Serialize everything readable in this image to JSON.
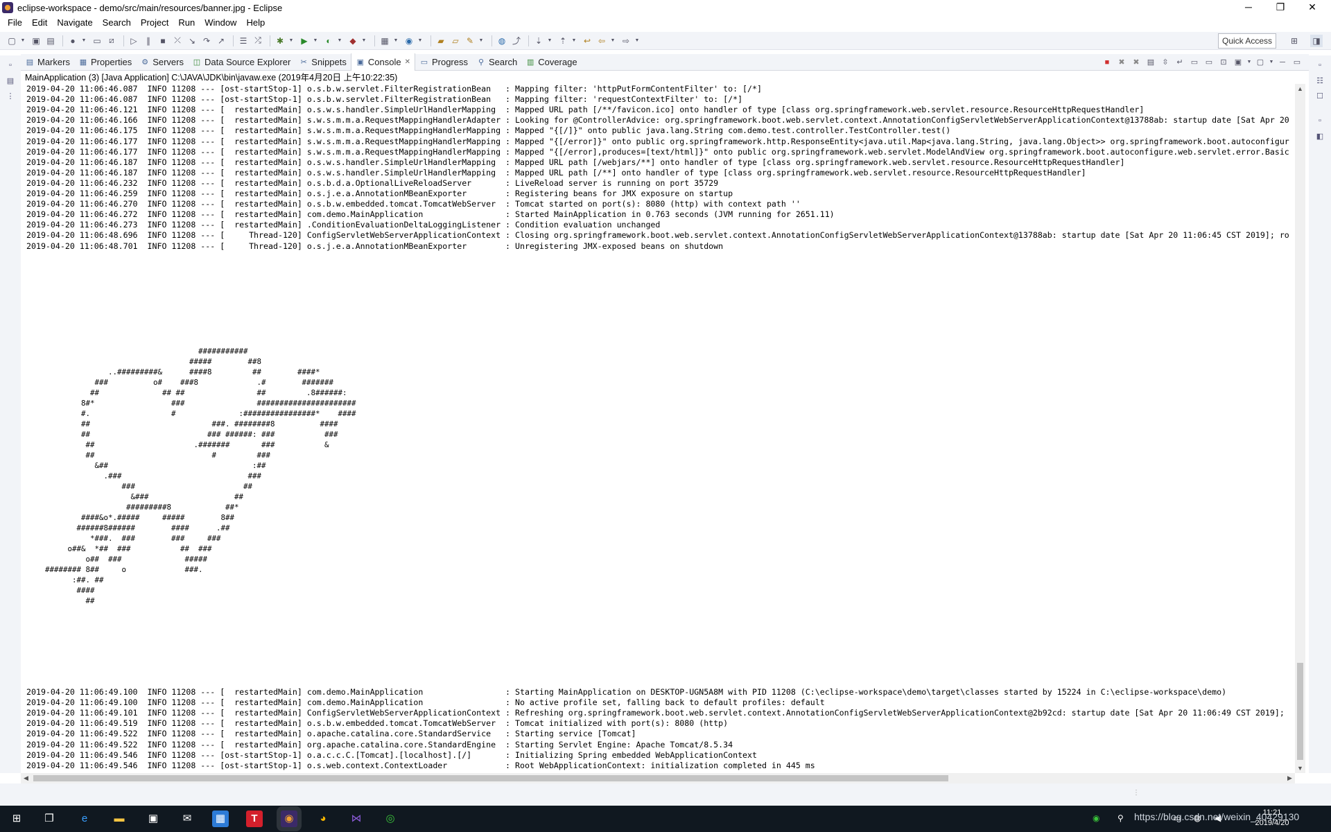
{
  "window": {
    "title": "eclipse-workspace - demo/src/main/resources/banner.jpg - Eclipse",
    "controls": {
      "minimize": "─",
      "maximize": "❐",
      "close": "✕"
    }
  },
  "menu": [
    "File",
    "Edit",
    "Navigate",
    "Search",
    "Project",
    "Run",
    "Window",
    "Help"
  ],
  "toolbar": {
    "quick_access": "Quick Access"
  },
  "view_tabs": [
    {
      "label": "Markers",
      "icon": "markers-icon",
      "glyph": "▤"
    },
    {
      "label": "Properties",
      "icon": "properties-icon",
      "glyph": "▦"
    },
    {
      "label": "Servers",
      "icon": "servers-icon",
      "glyph": "⚙"
    },
    {
      "label": "Data Source Explorer",
      "icon": "data-source-icon",
      "glyph": "◫"
    },
    {
      "label": "Snippets",
      "icon": "snippets-icon",
      "glyph": "✂"
    },
    {
      "label": "Console",
      "icon": "console-icon",
      "glyph": "▣",
      "close": "✕"
    },
    {
      "label": "Progress",
      "icon": "progress-icon",
      "glyph": "▭"
    },
    {
      "label": "Search",
      "icon": "search-icon",
      "glyph": "⚲"
    },
    {
      "label": "Coverage",
      "icon": "coverage-icon",
      "glyph": "▥"
    }
  ],
  "console": {
    "header": "MainApplication (3) [Java Application] C:\\JAVA\\JDK\\bin\\javaw.exe (2019年4月20日 上午10:22:35)",
    "log_top": [
      "2019-04-20 11:06:46.087  INFO 11208 --- [ost-startStop-1] o.s.b.w.servlet.FilterRegistrationBean   : Mapping filter: 'httpPutFormContentFilter' to: [/*]",
      "2019-04-20 11:06:46.087  INFO 11208 --- [ost-startStop-1] o.s.b.w.servlet.FilterRegistrationBean   : Mapping filter: 'requestContextFilter' to: [/*]",
      "2019-04-20 11:06:46.121  INFO 11208 --- [  restartedMain] o.s.w.s.handler.SimpleUrlHandlerMapping  : Mapped URL path [/**/favicon.ico] onto handler of type [class org.springframework.web.servlet.resource.ResourceHttpRequestHandler]",
      "2019-04-20 11:06:46.166  INFO 11208 --- [  restartedMain] s.w.s.m.m.a.RequestMappingHandlerAdapter : Looking for @ControllerAdvice: org.springframework.boot.web.servlet.context.AnnotationConfigServletWebServerApplicationContext@13788ab: startup date [Sat Apr 20",
      "2019-04-20 11:06:46.175  INFO 11208 --- [  restartedMain] s.w.s.m.m.a.RequestMappingHandlerMapping : Mapped \"{[/]}\" onto public java.lang.String com.demo.test.controller.TestController.test()",
      "2019-04-20 11:06:46.177  INFO 11208 --- [  restartedMain] s.w.s.m.m.a.RequestMappingHandlerMapping : Mapped \"{[/error]}\" onto public org.springframework.http.ResponseEntity<java.util.Map<java.lang.String, java.lang.Object>> org.springframework.boot.autoconfigur",
      "2019-04-20 11:06:46.177  INFO 11208 --- [  restartedMain] s.w.s.m.m.a.RequestMappingHandlerMapping : Mapped \"{[/error],produces=[text/html]}\" onto public org.springframework.web.servlet.ModelAndView org.springframework.boot.autoconfigure.web.servlet.error.Basic",
      "2019-04-20 11:06:46.187  INFO 11208 --- [  restartedMain] o.s.w.s.handler.SimpleUrlHandlerMapping  : Mapped URL path [/webjars/**] onto handler of type [class org.springframework.web.servlet.resource.ResourceHttpRequestHandler]",
      "2019-04-20 11:06:46.187  INFO 11208 --- [  restartedMain] o.s.w.s.handler.SimpleUrlHandlerMapping  : Mapped URL path [/**] onto handler of type [class org.springframework.web.servlet.resource.ResourceHttpRequestHandler]",
      "2019-04-20 11:06:46.232  INFO 11208 --- [  restartedMain] o.s.b.d.a.OptionalLiveReloadServer       : LiveReload server is running on port 35729",
      "2019-04-20 11:06:46.259  INFO 11208 --- [  restartedMain] o.s.j.e.a.AnnotationMBeanExporter        : Registering beans for JMX exposure on startup",
      "2019-04-20 11:06:46.270  INFO 11208 --- [  restartedMain] o.s.b.w.embedded.tomcat.TomcatWebServer  : Tomcat started on port(s): 8080 (http) with context path ''",
      "2019-04-20 11:06:46.272  INFO 11208 --- [  restartedMain] com.demo.MainApplication                 : Started MainApplication in 0.763 seconds (JVM running for 2651.11)",
      "2019-04-20 11:06:46.273  INFO 11208 --- [  restartedMain] .ConditionEvaluationDeltaLoggingListener : Condition evaluation unchanged",
      "2019-04-20 11:06:48.696  INFO 11208 --- [     Thread-120] ConfigServletWebServerApplicationContext : Closing org.springframework.boot.web.servlet.context.AnnotationConfigServletWebServerApplicationContext@13788ab: startup date [Sat Apr 20 11:06:45 CST 2019]; ro",
      "2019-04-20 11:06:48.701  INFO 11208 --- [     Thread-120] o.s.j.e.a.AnnotationMBeanExporter        : Unregistering JMX-exposed beans on shutdown"
    ],
    "banner": "                                    ###########\n                                  #####        ##8\n                ..#########&      ####8         ##        ####*\n             ###          o#    ###8             .#        #######\n            ##              ## ##                ##         .8######:\n          8#*                 ###                ######################\n          #.                  #              :################*    ####\n          ##                           ###. ########8          ####\n          ##                          ### ######: ###           ###\n           ##                      .#######       ###           &\n           ##                          #         ###\n             &##                                :##\n               .###                            ###\n                   ###                        ##\n                     &###                   ##\n                    #########8            ##*\n          ####&o*.#####     #####        8##\n         ######8######        ####      .##\n            *###.  ###        ###     ###\n       o##&  *##  ###           ##  ###\n           o##  ###              #####\n  ######## 8##     o             ###.\n        :##. ##\n         ####\n           ##",
    "log_bottom": [
      "2019-04-20 11:06:49.100  INFO 11208 --- [  restartedMain] com.demo.MainApplication                 : Starting MainApplication on DESKTOP-UGN5A8M with PID 11208 (C:\\eclipse-workspace\\demo\\target\\classes started by 15224 in C:\\eclipse-workspace\\demo)",
      "2019-04-20 11:06:49.100  INFO 11208 --- [  restartedMain] com.demo.MainApplication                 : No active profile set, falling back to default profiles: default",
      "2019-04-20 11:06:49.101  INFO 11208 --- [  restartedMain] ConfigServletWebServerApplicationContext : Refreshing org.springframework.boot.web.servlet.context.AnnotationConfigServletWebServerApplicationContext@2b92cd: startup date [Sat Apr 20 11:06:49 CST 2019];",
      "2019-04-20 11:06:49.519  INFO 11208 --- [  restartedMain] o.s.b.w.embedded.tomcat.TomcatWebServer  : Tomcat initialized with port(s): 8080 (http)",
      "2019-04-20 11:06:49.522  INFO 11208 --- [  restartedMain] o.apache.catalina.core.StandardService   : Starting service [Tomcat]",
      "2019-04-20 11:06:49.522  INFO 11208 --- [  restartedMain] org.apache.catalina.core.StandardEngine  : Starting Servlet Engine: Apache Tomcat/8.5.34",
      "2019-04-20 11:06:49.546  INFO 11208 --- [ost-startStop-1] o.a.c.c.C.[Tomcat].[localhost].[/]       : Initializing Spring embedded WebApplicationContext",
      "2019-04-20 11:06:49.546  INFO 11208 --- [ost-startStop-1] o.s.web.context.ContextLoader            : Root WebApplicationContext: initialization completed in 445 ms"
    ]
  },
  "taskbar": {
    "clock_time": "11:21",
    "clock_date": "2019/4/20",
    "watermark": "https://blog.csdn.net/weixin_40429130"
  },
  "colors": {
    "accent": "#0078d7",
    "taskbar": "#101820",
    "trim": "#f2f4f8",
    "stop_button": "#d03030"
  }
}
